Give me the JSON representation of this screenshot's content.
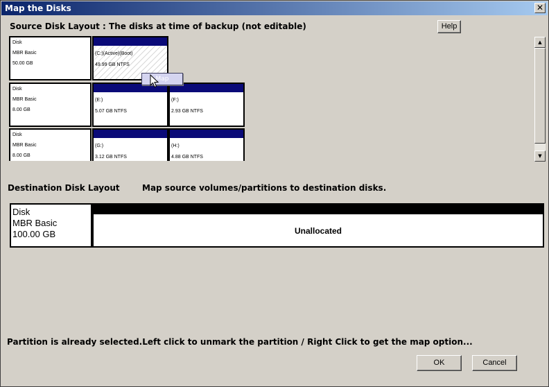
{
  "window": {
    "title": "Map the Disks",
    "close_glyph": "✕"
  },
  "source": {
    "heading": "Source Disk Layout : The disks at time of backup (not editable)",
    "disks": [
      {
        "label": "Disk",
        "type": "MBR Basic",
        "size": "50.00 GB",
        "partitions": [
          {
            "name": "(C:)(Active)(Boot)",
            "size": "49.99 GB NTFS",
            "selected": true
          }
        ]
      },
      {
        "label": "Disk",
        "type": "MBR Basic",
        "size": "8.00 GB",
        "partitions": [
          {
            "name": "(E:)",
            "size": "5.07 GB NTFS"
          },
          {
            "name": "(F:)",
            "size": "2.93 GB NTFS"
          }
        ]
      },
      {
        "label": "Disk",
        "type": "MBR Basic",
        "size": "8.00 GB",
        "partitions": [
          {
            "name": "(G:)",
            "size": "3.12 GB NTFS"
          },
          {
            "name": "(H:)",
            "size": "4.88 GB NTFS"
          }
        ]
      }
    ],
    "popup_label": "Map"
  },
  "help_label": "Help",
  "destination": {
    "heading": "Destination Disk Layout",
    "instruction": "Map source volumes/partitions to destination disks.",
    "disk": {
      "label": "Disk",
      "type": "MBR Basic",
      "size": "100.00 GB"
    },
    "unallocated_label": "Unallocated"
  },
  "status_text": "Partition is already selected.Left click to unmark the partition / Right Click to get the map option...",
  "buttons": {
    "ok": "OK",
    "cancel": "Cancel"
  },
  "scrollbar": {
    "up_glyph": "▲",
    "down_glyph": "▼"
  },
  "colors": {
    "title_start": "#0a246a",
    "partition_bar": "#0a0a78",
    "dialog_bg": "#d4d0c8"
  }
}
